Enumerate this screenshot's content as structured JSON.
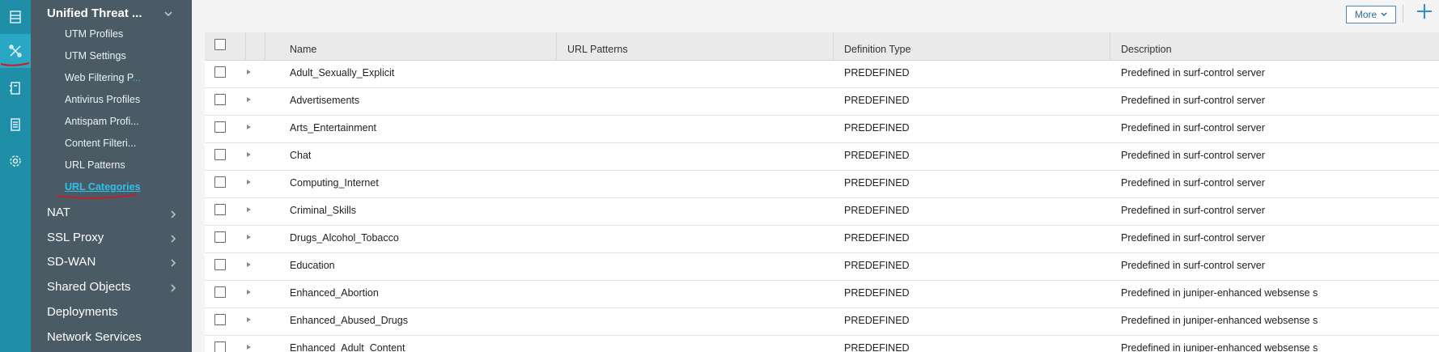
{
  "sidebar": {
    "section_title": "Unified Threat ...",
    "sub_items": [
      {
        "label": "UTM Profiles"
      },
      {
        "label": "UTM Settings"
      },
      {
        "label": "Web Filtering P",
        "suffix": "..."
      },
      {
        "label": "Antivirus Profiles"
      },
      {
        "label": "Antispam Profi..."
      },
      {
        "label": "Content Filteri..."
      },
      {
        "label": "URL Patterns"
      },
      {
        "label": "URL Categories"
      }
    ],
    "sections": [
      {
        "label": "NAT"
      },
      {
        "label": "SSL Proxy"
      },
      {
        "label": "SD-WAN"
      },
      {
        "label": "Shared Objects"
      },
      {
        "label": "Deployments"
      },
      {
        "label": "Network Services"
      }
    ]
  },
  "rail_icons": [
    "list-icon",
    "tools-icon",
    "devices-icon",
    "report-icon",
    "settings-gear-icon"
  ],
  "toolbar": {
    "more_label": "More"
  },
  "table": {
    "columns": [
      "Name",
      "URL Patterns",
      "Definition Type",
      "Description"
    ],
    "rows": [
      {
        "name": "Adult_Sexually_Explicit",
        "url_patterns": "",
        "definition_type": "PREDEFINED",
        "description": "Predefined in surf-control server"
      },
      {
        "name": "Advertisements",
        "url_patterns": "",
        "definition_type": "PREDEFINED",
        "description": "Predefined in surf-control server"
      },
      {
        "name": "Arts_Entertainment",
        "url_patterns": "",
        "definition_type": "PREDEFINED",
        "description": "Predefined in surf-control server"
      },
      {
        "name": "Chat",
        "url_patterns": "",
        "definition_type": "PREDEFINED",
        "description": "Predefined in surf-control server"
      },
      {
        "name": "Computing_Internet",
        "url_patterns": "",
        "definition_type": "PREDEFINED",
        "description": "Predefined in surf-control server"
      },
      {
        "name": "Criminal_Skills",
        "url_patterns": "",
        "definition_type": "PREDEFINED",
        "description": "Predefined in surf-control server"
      },
      {
        "name": "Drugs_Alcohol_Tobacco",
        "url_patterns": "",
        "definition_type": "PREDEFINED",
        "description": "Predefined in surf-control server"
      },
      {
        "name": "Education",
        "url_patterns": "",
        "definition_type": "PREDEFINED",
        "description": "Predefined in surf-control server"
      },
      {
        "name": "Enhanced_Abortion",
        "url_patterns": "",
        "definition_type": "PREDEFINED",
        "description": "Predefined in juniper-enhanced websense s"
      },
      {
        "name": "Enhanced_Abused_Drugs",
        "url_patterns": "",
        "definition_type": "PREDEFINED",
        "description": "Predefined in juniper-enhanced websense s"
      },
      {
        "name": "Enhanced_Adult_Content",
        "url_patterns": "",
        "definition_type": "PREDEFINED",
        "description": "Predefined in juniper-enhanced websense s"
      }
    ]
  },
  "colors": {
    "rail": "#1f8fa8",
    "sidebar": "#4a5b66",
    "active_link": "#2cc3ea",
    "annotation": "#d8141c"
  }
}
